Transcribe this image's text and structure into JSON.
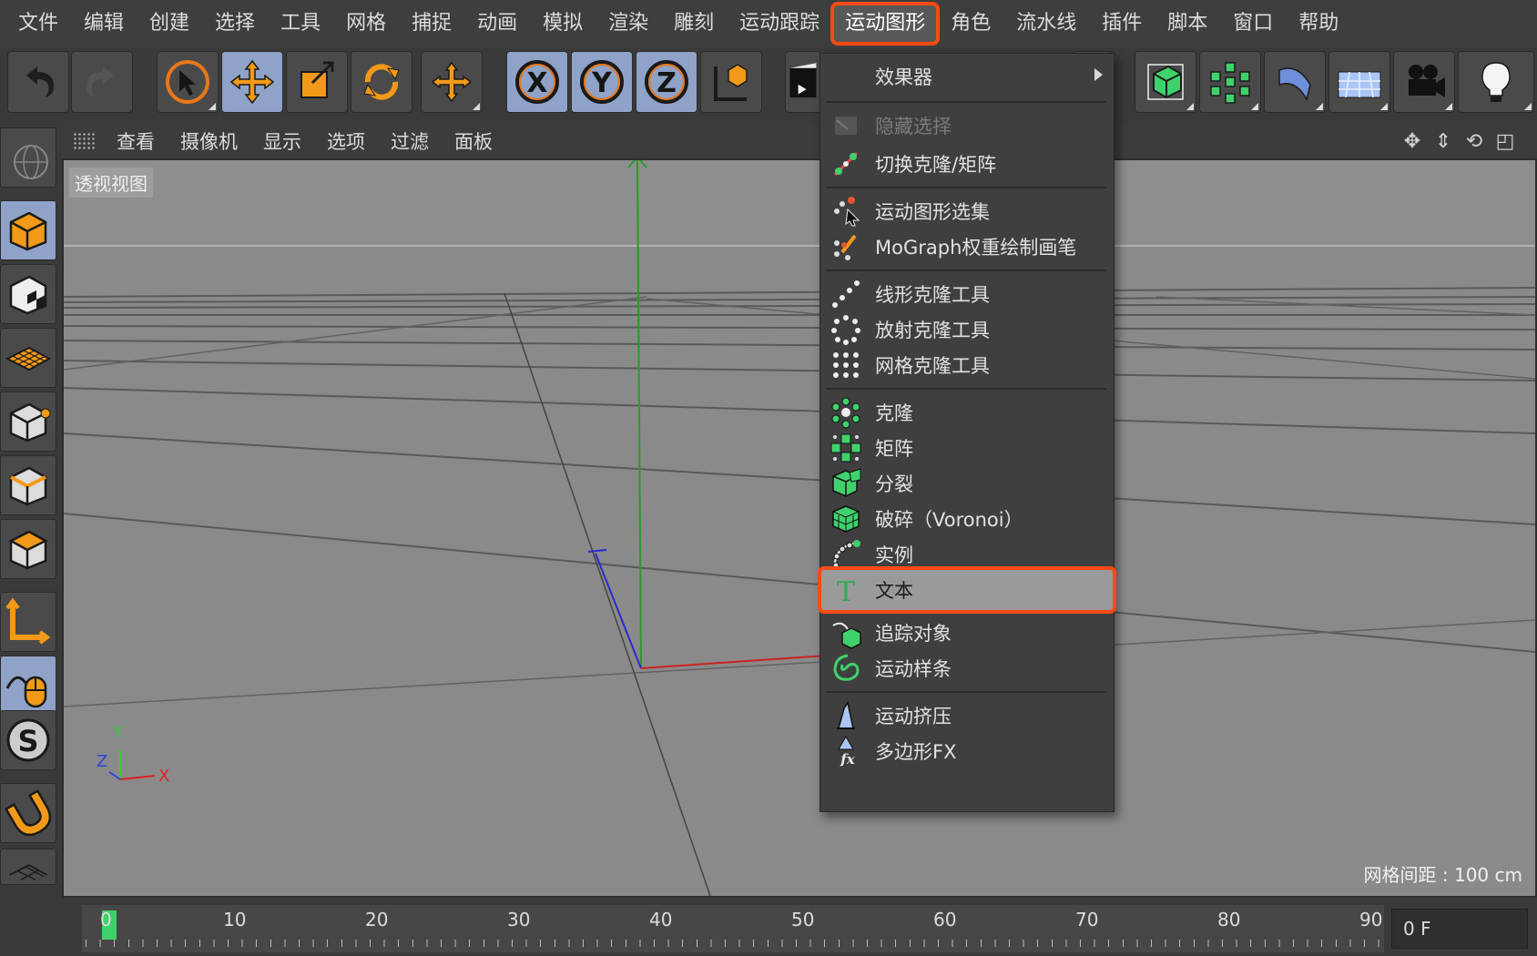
{
  "menubar": {
    "items": [
      "文件",
      "编辑",
      "创建",
      "选择",
      "工具",
      "网格",
      "捕捉",
      "动画",
      "模拟",
      "渲染",
      "雕刻",
      "运动跟踪",
      "运动图形",
      "角色",
      "流水线",
      "插件",
      "脚本",
      "窗口",
      "帮助"
    ],
    "active_index": 12
  },
  "viewport": {
    "menu": [
      "查看",
      "摄像机",
      "显示",
      "选项",
      "过滤",
      "面板"
    ],
    "view_label": "透视视图",
    "grid_spacing": "网格间距 : 100 cm",
    "axis_labels": {
      "x": "X",
      "y": "Y",
      "z": "Z"
    }
  },
  "timeline": {
    "ticks": [
      "0",
      "10",
      "20",
      "30",
      "40",
      "50",
      "60",
      "70",
      "80",
      "90"
    ],
    "current_frame": "0 F"
  },
  "dropdown": {
    "items": [
      {
        "label": "效果器",
        "icon": "effector-icon",
        "submenu": true
      },
      {
        "label": "隐藏选择",
        "icon": "hide-selection-icon",
        "disabled": true
      },
      {
        "label": "切换克隆/矩阵",
        "icon": "toggle-clone-matrix-icon"
      },
      {
        "label": "运动图形选集",
        "icon": "mograph-selection-icon"
      },
      {
        "label": "MoGraph权重绘制画笔",
        "icon": "weight-paint-brush-icon"
      },
      {
        "label": "线形克隆工具",
        "icon": "linear-clone-icon"
      },
      {
        "label": "放射克隆工具",
        "icon": "radial-clone-icon"
      },
      {
        "label": "网格克隆工具",
        "icon": "grid-clone-icon"
      },
      {
        "label": "克隆",
        "icon": "cloner-icon"
      },
      {
        "label": "矩阵",
        "icon": "matrix-icon"
      },
      {
        "label": "分裂",
        "icon": "fracture-icon"
      },
      {
        "label": "破碎（Voronoi）",
        "icon": "voronoi-fracture-icon"
      },
      {
        "label": "实例",
        "icon": "instance-icon"
      },
      {
        "label": "文本",
        "icon": "text-icon",
        "highlighted": true
      },
      {
        "label": "追踪对象",
        "icon": "tracer-icon"
      },
      {
        "label": "运动样条",
        "icon": "mospline-icon"
      },
      {
        "label": "运动挤压",
        "icon": "moextrude-icon"
      },
      {
        "label": "多边形FX",
        "icon": "polyfx-icon"
      }
    ]
  },
  "colors": {
    "highlight_outline": "#ff4a13",
    "axis_x": "#cc2222",
    "axis_y": "#22aa22",
    "axis_z": "#2222cc",
    "mograph_green": "#3fd26c",
    "tool_orange": "#f29a18"
  }
}
